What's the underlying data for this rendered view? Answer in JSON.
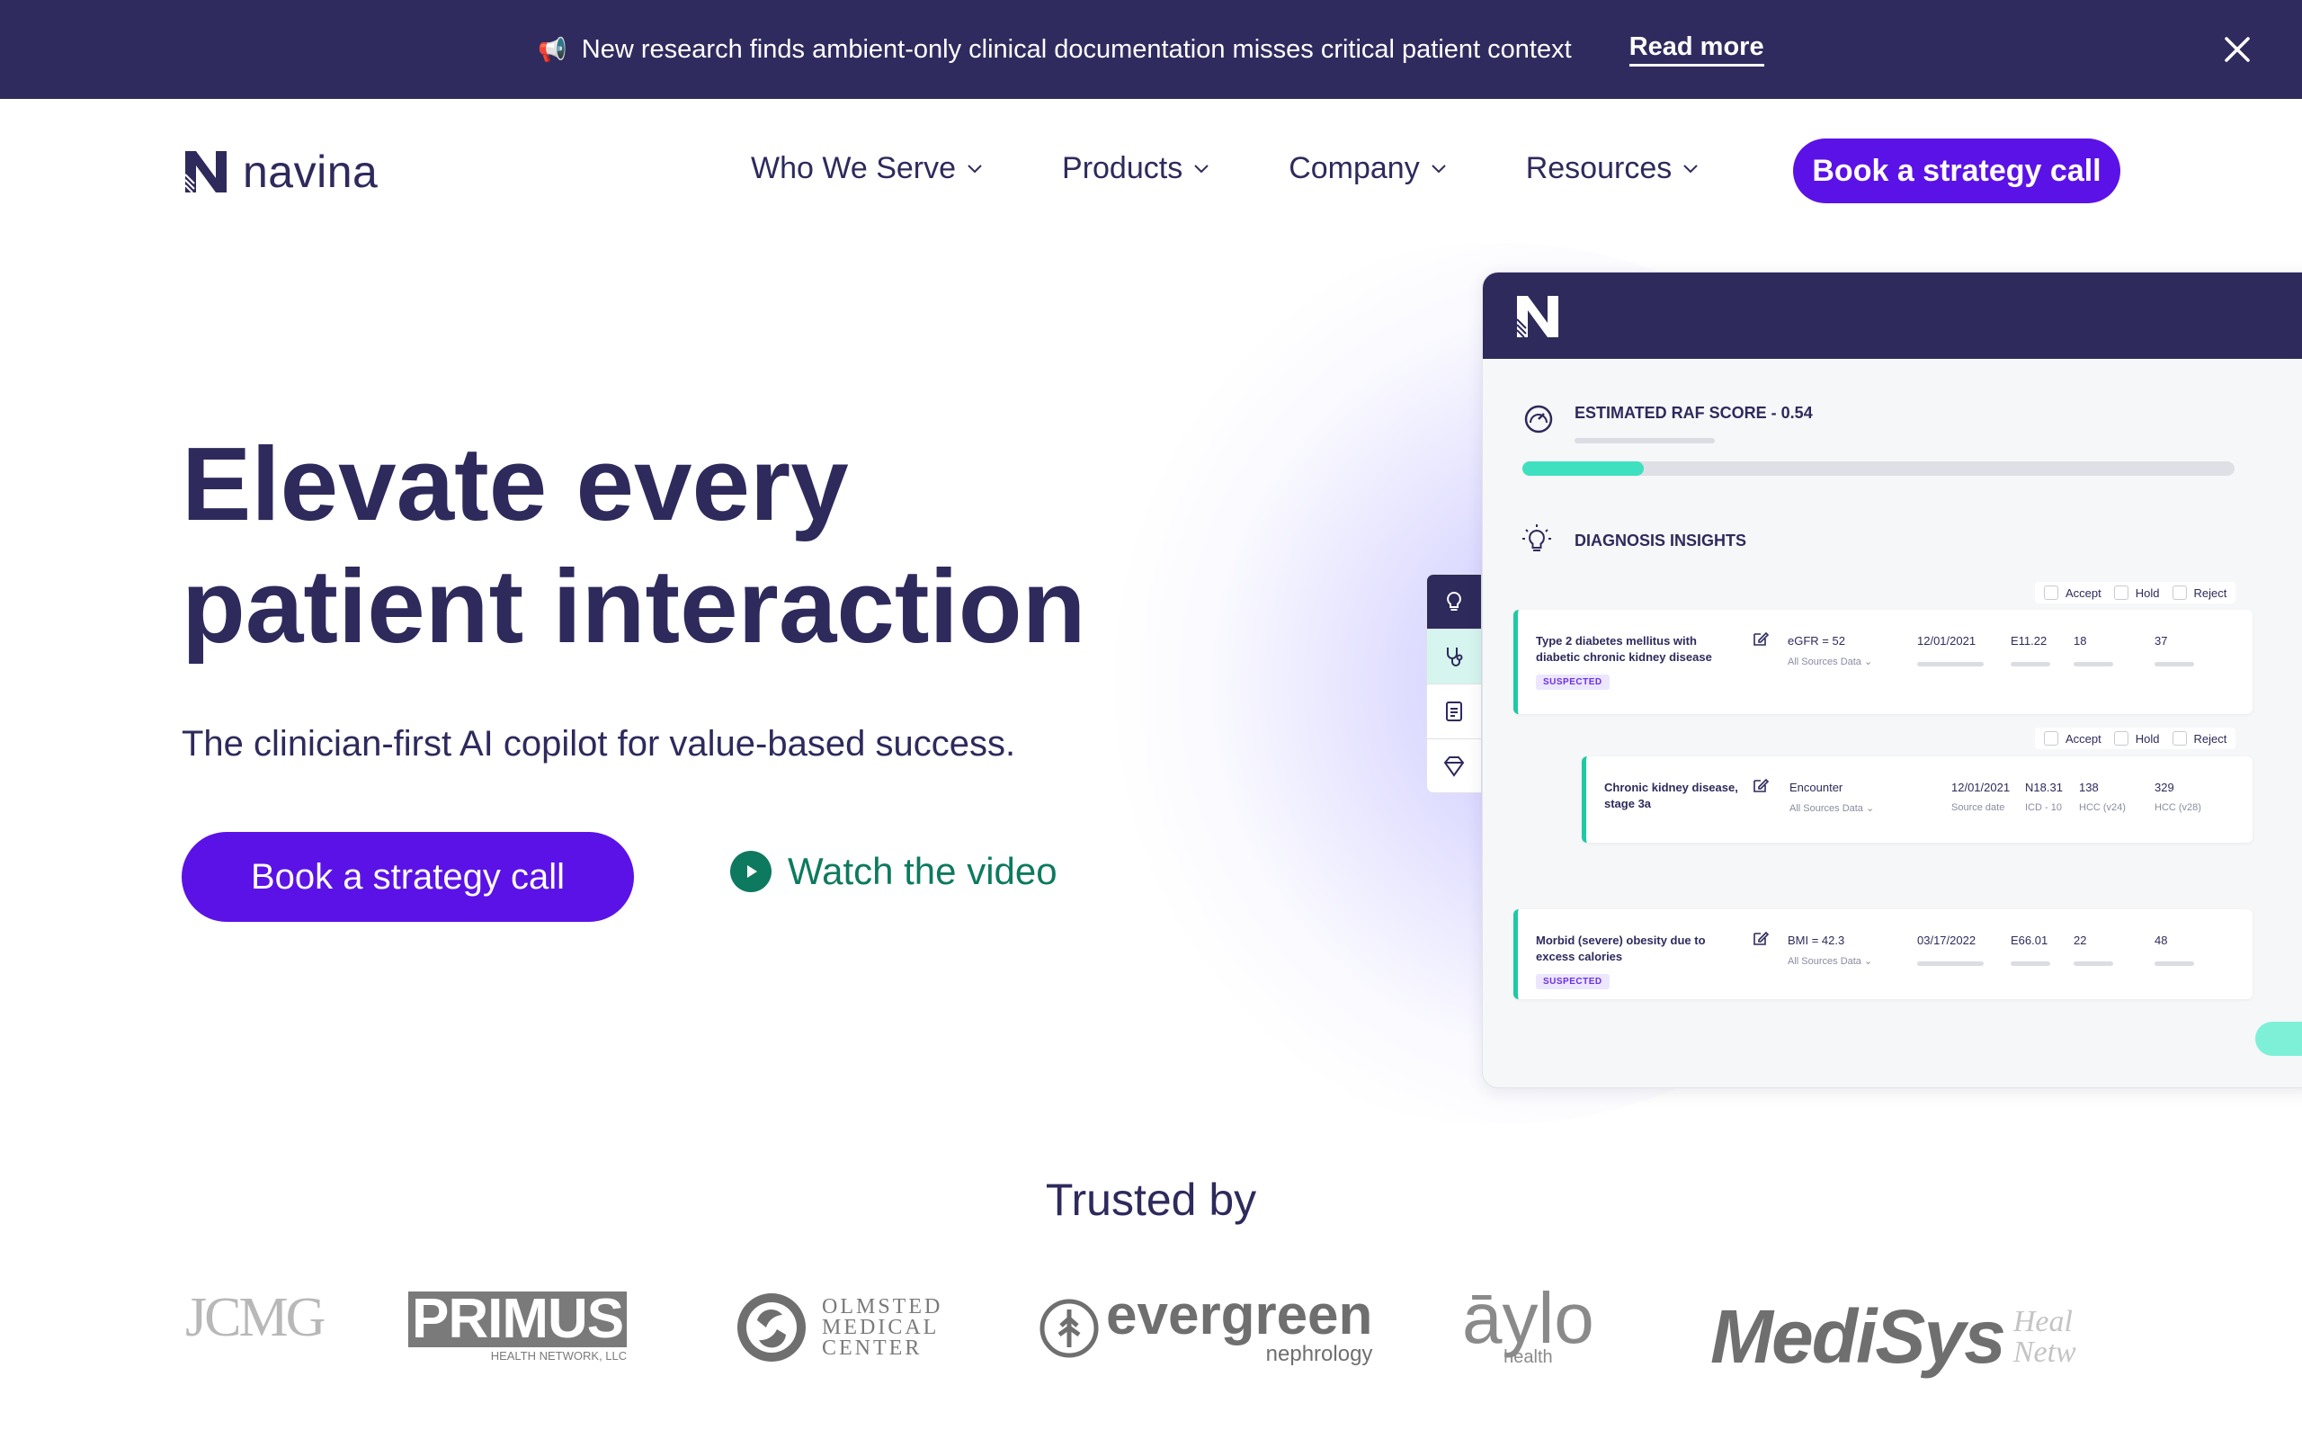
{
  "announcement": {
    "text": "New research finds ambient-only clinical documentation misses critical patient context",
    "link": "Read more"
  },
  "header": {
    "brand": "navina",
    "nav": [
      "Who We Serve",
      "Products",
      "Company",
      "Resources"
    ],
    "cta": "Book a strategy call"
  },
  "hero": {
    "title_line1": "Elevate every",
    "title_line2": "patient interaction",
    "subtitle": "The clinician-first AI copilot for value-based success.",
    "cta": "Book a strategy call",
    "video": "Watch the video"
  },
  "card": {
    "raf_label": "ESTIMATED RAF SCORE - 0.54",
    "raf_progress": 0.17,
    "insights_label": "DIAGNOSIS INSIGHTS",
    "checks": {
      "accept": "Accept",
      "hold": "Hold",
      "reject": "Reject"
    },
    "rows": [
      {
        "diagnosis": "Type 2 diabetes mellitus with diabetic chronic kidney disease",
        "badge": "SUSPECTED",
        "evidence": "eGFR = 52",
        "source": "All Sources Data",
        "date": "12/01/2021",
        "icd": "E11.22",
        "hcc24": "18",
        "hcc28": "37"
      },
      {
        "diagnosis": "Chronic kidney disease, stage 3a",
        "evidence": "Encounter",
        "source": "All Sources Data",
        "date": "12/01/2021",
        "date_label": "Source date",
        "icd": "N18.31",
        "icd_label": "ICD - 10",
        "hcc24": "138",
        "hcc24_label": "HCC (v24)",
        "hcc28": "329",
        "hcc28_label": "HCC (v28)"
      },
      {
        "diagnosis": "Morbid (severe) obesity due to excess calories",
        "badge": "SUSPECTED",
        "evidence": "BMI = 42.3",
        "source": "All Sources Data",
        "date": "03/17/2022",
        "icd": "E66.01",
        "hcc24": "22",
        "hcc28": "48"
      }
    ]
  },
  "trusted": {
    "heading": "Trusted by",
    "logos": {
      "jcmg": "JCMG",
      "primus": "PRIMUS",
      "primus_sub": "HEALTH NETWORK, LLC",
      "olmsted1": "OLMSTED",
      "olmsted2": "MEDICAL",
      "olmsted3": "CENTER",
      "evergreen": "evergreen",
      "evergreen_sub": "nephrology",
      "aylo": "āylo",
      "aylo_sub": "health",
      "medisys": "MediSys",
      "medisys_sub1": "Heal",
      "medisys_sub2": "Netw"
    }
  },
  "colors": {
    "navy": "#302b5e",
    "purple": "#5b12e6",
    "teal": "#0d7a5f",
    "mint": "#3fe0c0"
  }
}
